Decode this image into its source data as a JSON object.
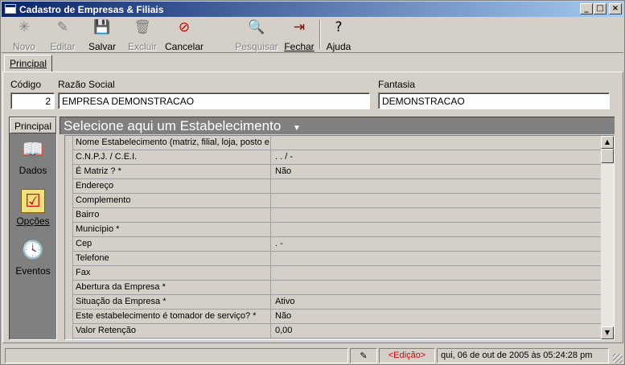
{
  "window": {
    "title": "Cadastro de Empresas & Filiais",
    "controls": [
      "_",
      "□",
      "×"
    ]
  },
  "toolbar": {
    "novo": "Novo",
    "editar": "Editar",
    "salvar": "Salvar",
    "excluir": "Excluir",
    "cancelar": "Cancelar",
    "pesquisar": "Pesquisar",
    "fechar": "Fechar",
    "ajuda": "Ajuda",
    "icons": {
      "novo": "✳",
      "editar": "✎",
      "salvar": "💾",
      "excluir": "🗑",
      "cancelar": "⊘",
      "pesquisar": "🔍",
      "fechar": "⇥",
      "ajuda": "?"
    }
  },
  "outer_tab": {
    "label": "Principal"
  },
  "form": {
    "codigo_label": "Código",
    "codigo_value": "2",
    "razao_label": "Razão Social",
    "razao_value": "EMPRESA DEMONSTRACAO",
    "fantasia_label": "Fantasia",
    "fantasia_value": "DEMONSTRACAO"
  },
  "nav": {
    "header": "Principal",
    "items": [
      {
        "label": "Dados",
        "icon": "📖"
      },
      {
        "label": "Opções",
        "icon": "☑"
      },
      {
        "label": "Eventos",
        "icon": "🕓"
      }
    ]
  },
  "estab_header": {
    "label": "Selecione aqui um Estabelecimento",
    "caret": "▼"
  },
  "grid": {
    "rows": [
      {
        "label": "Nome Estabelecimento (matriz, filial, loja, posto e ...",
        "value": ""
      },
      {
        "label": "C.N.P.J. / C.E.I.",
        "value": "  .   .   /    -"
      },
      {
        "label": "É Matriz ? *",
        "value": "Não"
      },
      {
        "label": "Endereço",
        "value": ""
      },
      {
        "label": "Complemento",
        "value": ""
      },
      {
        "label": "Bairro",
        "value": ""
      },
      {
        "label": "Município *",
        "value": ""
      },
      {
        "label": "Cep",
        "value": "  .   -"
      },
      {
        "label": "Telefone",
        "value": ""
      },
      {
        "label": "Fax",
        "value": ""
      },
      {
        "label": "Abertura da Empresa *",
        "value": ""
      },
      {
        "label": "Situação da Empresa *",
        "value": "Ativo"
      },
      {
        "label": "Este estabelecimento é tomador de serviço? *",
        "value": "Não"
      },
      {
        "label": "Valor Retenção",
        "value": "0,00"
      }
    ],
    "scroll_up": "▲",
    "scroll_down": "▼"
  },
  "status": {
    "mode": "<Edição>",
    "datetime": "qui, 06 de out de 2005 às 05:24:28 pm",
    "pen_icon": "✎"
  }
}
